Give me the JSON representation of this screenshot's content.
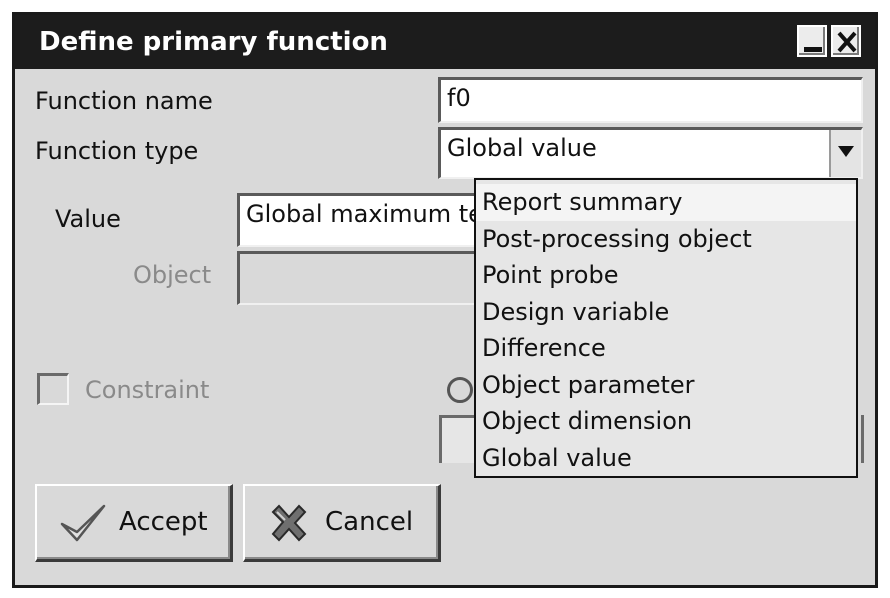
{
  "window": {
    "title": "Define primary function"
  },
  "form": {
    "function_name_label": "Function name",
    "function_name_value": "f0",
    "function_type_label": "Function type",
    "function_type_value": "Global value",
    "value_label": "Value",
    "value_value": "Global maximum te",
    "object_label": "Object",
    "object_value": "",
    "constraint_label": "Constraint",
    "constraint_checked": false
  },
  "dropdown": {
    "options": [
      "Report summary",
      "Post-processing object",
      "Point probe",
      "Design variable",
      "Difference",
      "Object parameter",
      "Object dimension",
      "Global value"
    ],
    "hovered_index": 0
  },
  "buttons": {
    "accept_label": "Accept",
    "accept_icon": "checkmark-icon",
    "cancel_label": "Cancel",
    "cancel_icon": "x-icon"
  }
}
